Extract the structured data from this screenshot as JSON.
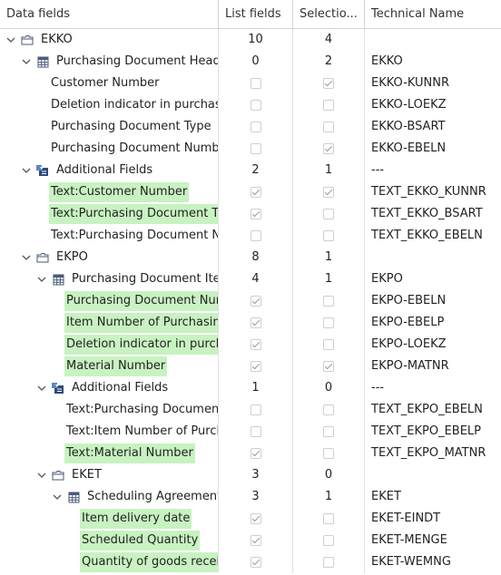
{
  "headers": {
    "data_fields": "Data fields",
    "list_fields": "List fields",
    "selection": "Selectio...",
    "technical_name": "Technical Name"
  },
  "rows": [
    {
      "level": 0,
      "expand": "down",
      "icon": "folder",
      "label": "EKKO",
      "list": "10",
      "sel": "4",
      "tech": ""
    },
    {
      "level": 1,
      "expand": "down",
      "icon": "table",
      "label": "Purchasing Document Header",
      "list": "0",
      "sel": "2",
      "tech": "EKKO"
    },
    {
      "level": 2,
      "label": "Customer Number",
      "list_cb": false,
      "sel_cb": true,
      "tech": "EKKO-KUNNR"
    },
    {
      "level": 2,
      "label": "Deletion indicator in purchasing document",
      "list_cb": false,
      "sel_cb": false,
      "tech": "EKKO-LOEKZ"
    },
    {
      "level": 2,
      "label": "Purchasing Document Type",
      "list_cb": false,
      "sel_cb": false,
      "tech": "EKKO-BSART"
    },
    {
      "level": 2,
      "label": "Purchasing Document Number",
      "list_cb": false,
      "sel_cb": true,
      "tech": "EKKO-EBELN"
    },
    {
      "level": 1,
      "expand": "down",
      "icon": "addfields",
      "label": "Additional Fields",
      "list": "2",
      "sel": "1",
      "tech": "---"
    },
    {
      "level": 2,
      "label": "Text:Customer Number",
      "hl": true,
      "list_cb": true,
      "sel_cb": true,
      "tech": "TEXT_EKKO_KUNNR"
    },
    {
      "level": 2,
      "label": "Text:Purchasing Document Type",
      "hl": true,
      "list_cb": true,
      "sel_cb": false,
      "tech": "TEXT_EKKO_BSART"
    },
    {
      "level": 2,
      "label": "Text:Purchasing Document Number",
      "list_cb": false,
      "sel_cb": false,
      "tech": "TEXT_EKKO_EBELN"
    },
    {
      "level": 1,
      "expand": "down",
      "icon": "folder",
      "label": "EKPO",
      "list": "8",
      "sel": "1",
      "tech": ""
    },
    {
      "level": 2,
      "expand": "down",
      "icon": "table",
      "label": "Purchasing Document Item",
      "list": "4",
      "sel": "1",
      "tech": "EKPO"
    },
    {
      "level": 3,
      "label": "Purchasing Document Number",
      "hl": true,
      "list_cb": true,
      "sel_cb": false,
      "tech": "EKPO-EBELN"
    },
    {
      "level": 3,
      "label": "Item Number of Purchasing Document",
      "hl": true,
      "list_cb": true,
      "sel_cb": false,
      "tech": "EKPO-EBELP"
    },
    {
      "level": 3,
      "label": "Deletion indicator in purchasing document",
      "hl": true,
      "list_cb": true,
      "sel_cb": false,
      "tech": "EKPO-LOEKZ"
    },
    {
      "level": 3,
      "label": "Material Number",
      "hl": true,
      "list_cb": true,
      "sel_cb": true,
      "tech": "EKPO-MATNR"
    },
    {
      "level": 2,
      "expand": "down",
      "icon": "addfields",
      "label": "Additional Fields",
      "list": "1",
      "sel": "0",
      "tech": "---"
    },
    {
      "level": 3,
      "label": "Text:Purchasing Document Number",
      "list_cb": false,
      "sel_cb": false,
      "tech": "TEXT_EKPO_EBELN"
    },
    {
      "level": 3,
      "label": "Text:Item Number of Purchasing Document",
      "list_cb": false,
      "sel_cb": false,
      "tech": "TEXT_EKPO_EBELP"
    },
    {
      "level": 3,
      "label": "Text:Material Number",
      "hl": true,
      "list_cb": true,
      "sel_cb": false,
      "tech": "TEXT_EKPO_MATNR"
    },
    {
      "level": 2,
      "expand": "down",
      "icon": "folder",
      "label": "EKET",
      "list": "3",
      "sel": "0",
      "tech": ""
    },
    {
      "level": 3,
      "expand": "down",
      "icon": "table",
      "label": "Scheduling Agreement Schedule Lines",
      "list": "3",
      "sel": "1",
      "tech": "EKET"
    },
    {
      "level": 4,
      "label": "Item delivery date",
      "hl": true,
      "list_cb": true,
      "sel_cb": false,
      "tech": "EKET-EINDT"
    },
    {
      "level": 4,
      "label": "Scheduled Quantity",
      "hl": true,
      "list_cb": true,
      "sel_cb": false,
      "tech": "EKET-MENGE"
    },
    {
      "level": 4,
      "label": "Quantity of goods received",
      "hl": true,
      "list_cb": true,
      "sel_cb": false,
      "tech": "EKET-WEMNG"
    }
  ]
}
